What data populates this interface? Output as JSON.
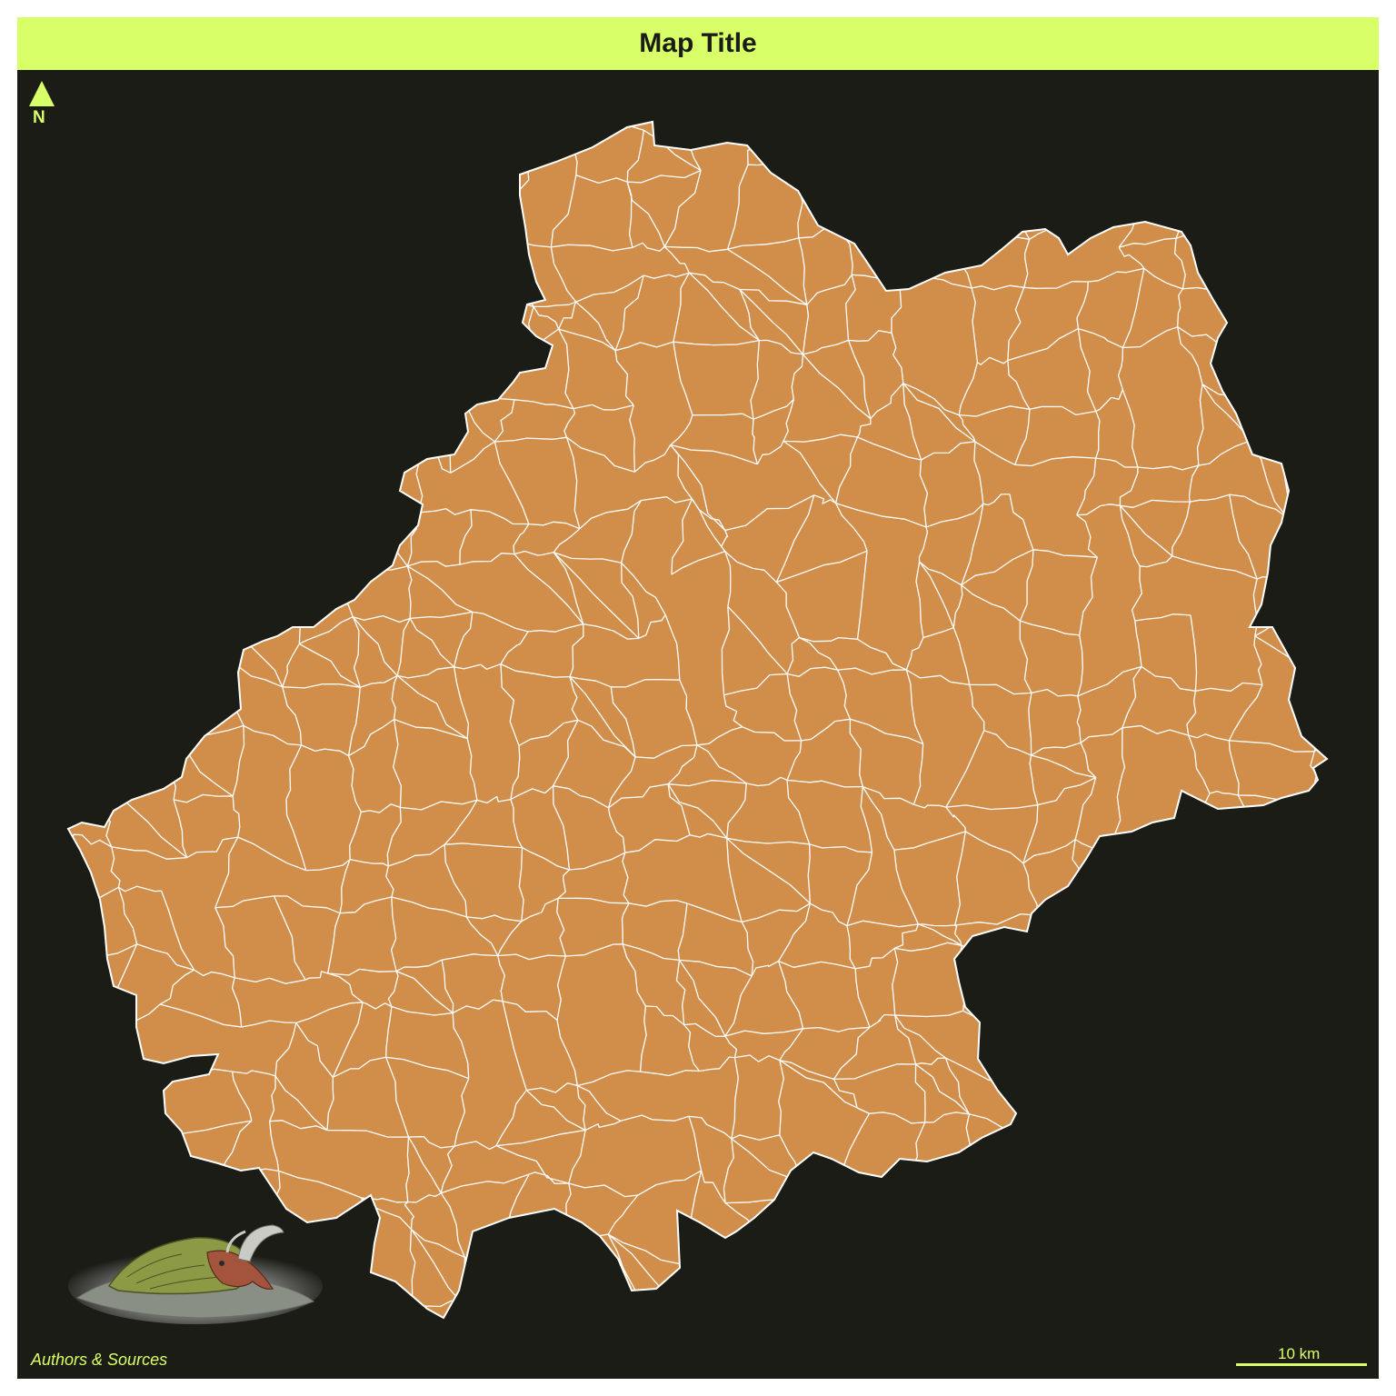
{
  "map": {
    "title": "Map Title",
    "credits": "Authors & Sources",
    "north_label": "N",
    "scale_label": "10 km",
    "colors": {
      "background": "#1c1c17",
      "accent": "#d9ff68",
      "fill": "#d18e4b",
      "border": "#ffffff"
    },
    "icons": [
      "north-arrow-icon",
      "sea-creature-illustration"
    ]
  }
}
